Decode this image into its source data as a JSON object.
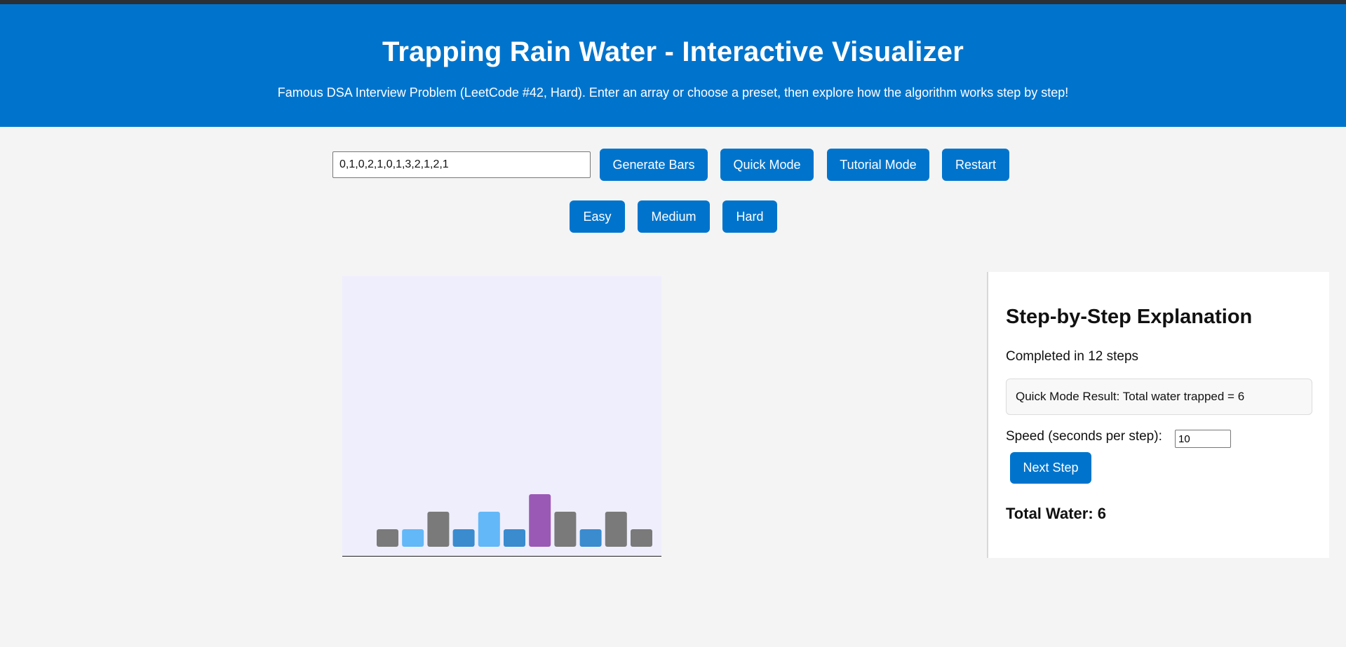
{
  "header": {
    "title": "Trapping Rain Water - Interactive Visualizer",
    "subtitle": "Famous DSA Interview Problem (LeetCode #42, Hard). Enter an array or choose a preset, then explore how the algorithm works step by step!"
  },
  "controls": {
    "array_value": "0,1,0,2,1,0,1,3,2,1,2,1",
    "generate_label": "Generate Bars",
    "quick_label": "Quick Mode",
    "tutorial_label": "Tutorial Mode",
    "restart_label": "Restart"
  },
  "presets": {
    "easy_label": "Easy",
    "medium_label": "Medium",
    "hard_label": "Hard"
  },
  "explanation": {
    "heading": "Step-by-Step Explanation",
    "steps_text": "Completed in 12 steps",
    "result_text": "Quick Mode Result: Total water trapped = 6",
    "speed_label": "Speed (seconds per step):",
    "speed_value": "10",
    "next_step_label": "Next Step",
    "total_water": "Total Water: 6"
  },
  "colors": {
    "header_bg": "#0074cc",
    "button_bg": "#0074cc",
    "chart_bg": "#efeefc",
    "bar_wall": "#7a7a7a",
    "bar_water_light": "#63b8f7",
    "bar_water_dark": "#3a8ccf",
    "bar_max": "#9b59b6"
  },
  "chart_data": {
    "type": "bar",
    "values": [
      1,
      1,
      2,
      1,
      2,
      1,
      3,
      2,
      1,
      2,
      1
    ],
    "bar_types": [
      "wall",
      "water-light",
      "wall",
      "water-dark",
      "water-light",
      "water-dark",
      "max",
      "wall",
      "water-dark",
      "wall",
      "wall"
    ]
  }
}
